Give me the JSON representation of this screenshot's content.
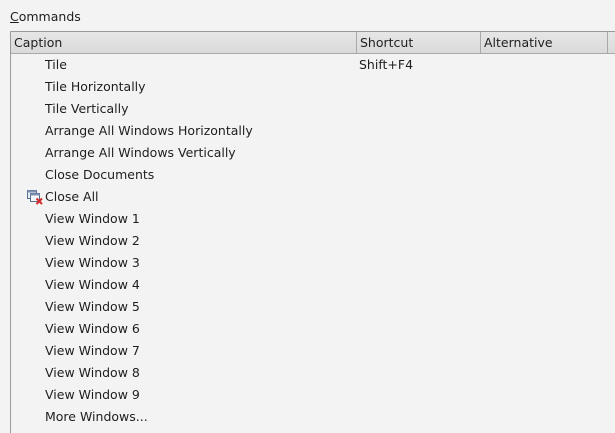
{
  "group": {
    "label_mnemonic": "C",
    "label_rest": "ommands"
  },
  "columns": {
    "caption": "Caption",
    "shortcut": "Shortcut",
    "alternative": "Alternative"
  },
  "rows": [
    {
      "caption": "Tile",
      "shortcut": "Shift+F4",
      "alternative": "",
      "icon": ""
    },
    {
      "caption": "Tile Horizontally",
      "shortcut": "",
      "alternative": "",
      "icon": ""
    },
    {
      "caption": "Tile Vertically",
      "shortcut": "",
      "alternative": "",
      "icon": ""
    },
    {
      "caption": "Arrange All Windows Horizontally",
      "shortcut": "",
      "alternative": "",
      "icon": ""
    },
    {
      "caption": "Arrange All Windows Vertically",
      "shortcut": "",
      "alternative": "",
      "icon": ""
    },
    {
      "caption": "Close Documents",
      "shortcut": "",
      "alternative": "",
      "icon": ""
    },
    {
      "caption": "Close All",
      "shortcut": "",
      "alternative": "",
      "icon": "close-all-icon"
    },
    {
      "caption": "View Window 1",
      "shortcut": "",
      "alternative": "",
      "icon": ""
    },
    {
      "caption": "View Window 2",
      "shortcut": "",
      "alternative": "",
      "icon": ""
    },
    {
      "caption": "View Window 3",
      "shortcut": "",
      "alternative": "",
      "icon": ""
    },
    {
      "caption": "View Window 4",
      "shortcut": "",
      "alternative": "",
      "icon": ""
    },
    {
      "caption": "View Window 5",
      "shortcut": "",
      "alternative": "",
      "icon": ""
    },
    {
      "caption": "View Window 6",
      "shortcut": "",
      "alternative": "",
      "icon": ""
    },
    {
      "caption": "View Window 7",
      "shortcut": "",
      "alternative": "",
      "icon": ""
    },
    {
      "caption": "View Window 8",
      "shortcut": "",
      "alternative": "",
      "icon": ""
    },
    {
      "caption": "View Window 9",
      "shortcut": "",
      "alternative": "",
      "icon": ""
    },
    {
      "caption": "More Windows...",
      "shortcut": "",
      "alternative": "",
      "icon": ""
    }
  ],
  "colors": {
    "background": "#f3f3f3",
    "header": "#dedede",
    "border": "#9a9a9a",
    "text": "#1e1e1e",
    "close_x": "#d22b2b"
  }
}
